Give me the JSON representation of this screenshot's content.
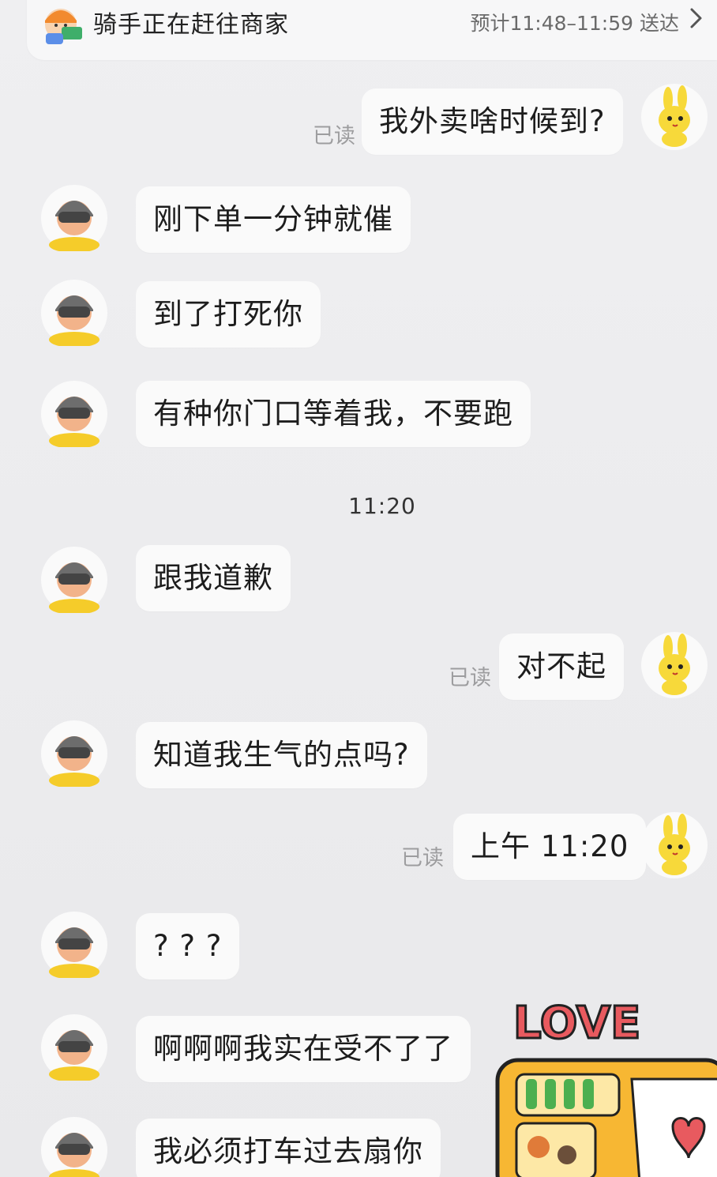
{
  "banner": {
    "title": "骑手正在赶往商家",
    "eta": "预计11:48–11:59 送达",
    "chevron_icon": "chevron-right-icon",
    "avatar_icon": "courier-avatar-icon"
  },
  "read_label": "已读",
  "timestamp": "11:20",
  "messages": [
    {
      "side": "right",
      "text": "我外卖啥时候到?",
      "read": true
    },
    {
      "side": "left",
      "text": "刚下单一分钟就催"
    },
    {
      "side": "left",
      "text": "到了打死你"
    },
    {
      "side": "left",
      "text": "有种你门口等着我，不要跑"
    },
    {
      "side": "left",
      "text": "跟我道歉"
    },
    {
      "side": "right",
      "text": "对不起",
      "read": true
    },
    {
      "side": "left",
      "text": "知道我生气的点吗?"
    },
    {
      "side": "right",
      "text": "上午 11:20",
      "read": true
    },
    {
      "side": "left",
      "text": "? ? ?"
    },
    {
      "side": "left",
      "text": "啊啊啊我实在受不了了"
    },
    {
      "side": "left",
      "text": "我必须打车过去扇你"
    }
  ],
  "sticker": {
    "text": "LOVE",
    "icon": "love-bento-sticker-icon"
  },
  "colors": {
    "background": "#ececee",
    "bubble": "#fafafa",
    "read_label": "#9d9d9f",
    "bunny_yellow": "#f7d93a",
    "sticker_red": "#e85a5f"
  }
}
